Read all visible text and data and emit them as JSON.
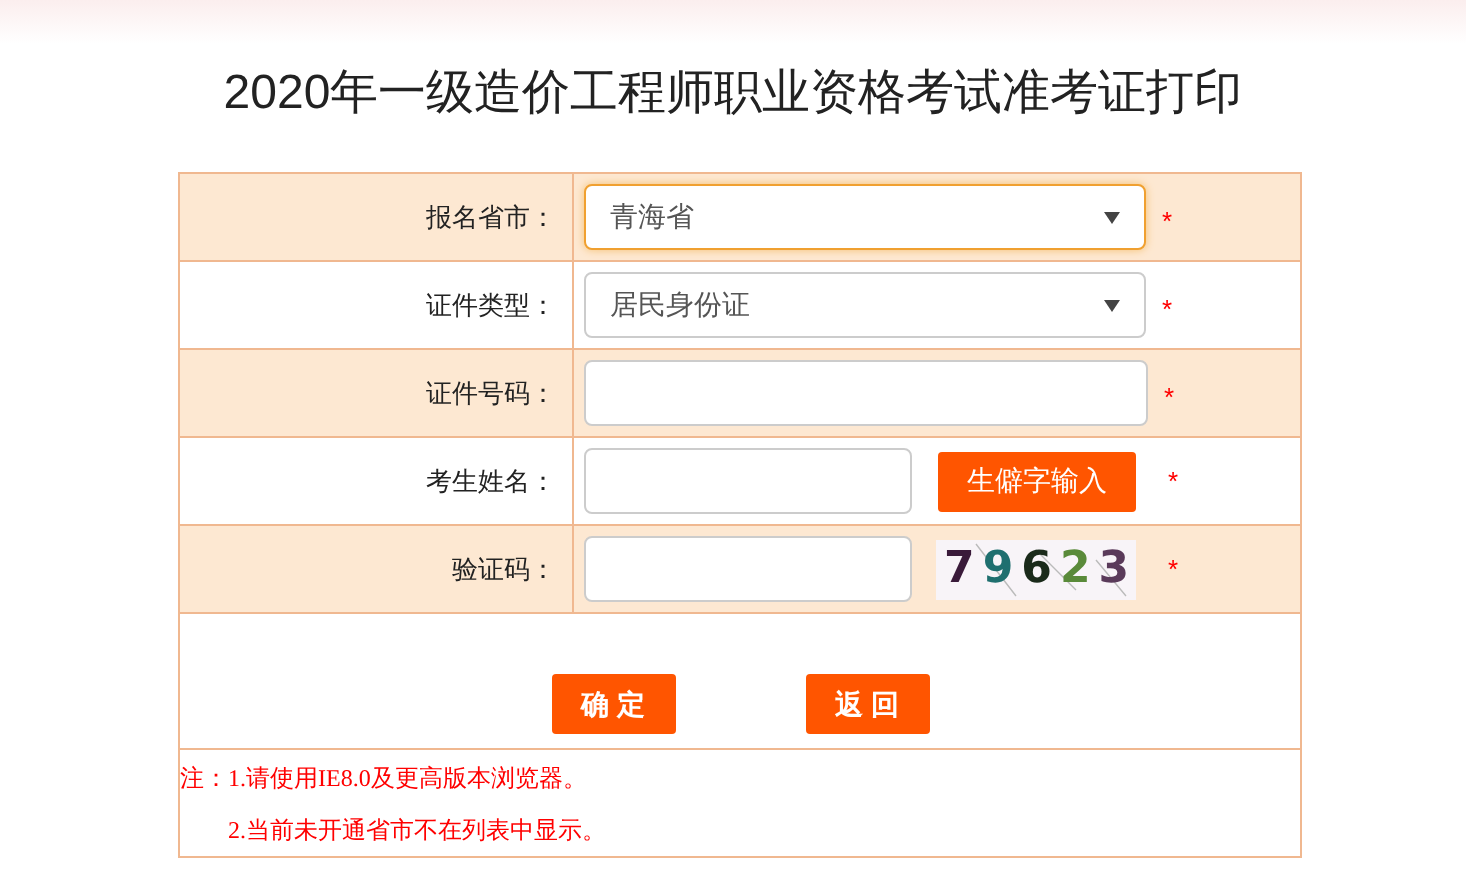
{
  "title": "2020年一级造价工程师职业资格考试准考证打印",
  "rows": [
    {
      "label": "报名省市：",
      "kind": "select",
      "value": "青海省",
      "focused": true,
      "required": "*"
    },
    {
      "label": "证件类型：",
      "kind": "select",
      "value": "居民身份证",
      "focused": false,
      "required": "*"
    },
    {
      "label": "证件号码：",
      "kind": "input",
      "required": "*"
    },
    {
      "label": "考生姓名：",
      "kind": "input-button",
      "button": "生僻字输入",
      "required": "*"
    },
    {
      "label": "验证码：",
      "kind": "captcha",
      "captcha": "79623",
      "required": "*"
    }
  ],
  "buttons": [
    "确 定",
    "返 回"
  ],
  "notes": [
    "注：1.请使用IE8.0及更高版本浏览器。",
    "2.当前未开通省市不在列表中显示。"
  ]
}
